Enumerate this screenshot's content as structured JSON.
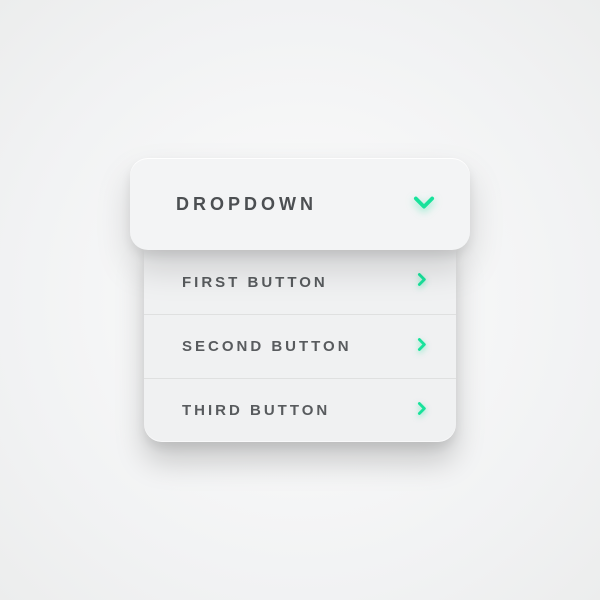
{
  "accent_color": "#18e29b",
  "dropdown": {
    "label": "DROPDOWN",
    "items": [
      {
        "label": "FIRST BUTTON"
      },
      {
        "label": "SECOND BUTTON"
      },
      {
        "label": "THIRD BUTTON"
      }
    ]
  }
}
